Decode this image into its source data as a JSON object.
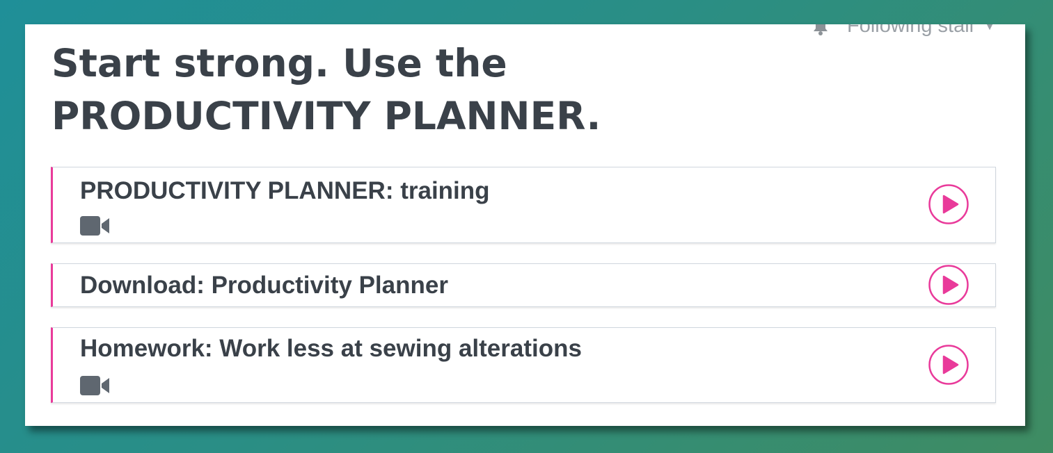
{
  "header": {
    "follow_label": "Following stall",
    "bell_icon": "bell-icon",
    "chevron_icon": "chevron-down-icon"
  },
  "section": {
    "title": "Start strong. Use the PRODUCTIVITY PLANNER."
  },
  "lessons": [
    {
      "title": "PRODUCTIVITY PLANNER: training",
      "has_video": true
    },
    {
      "title": "Download: Productivity Planner",
      "has_video": false
    },
    {
      "title": "Homework: Work less at sewing alterations",
      "has_video": true
    }
  ],
  "colors": {
    "accent": "#e93a9a",
    "text": "#3a4149",
    "icon": "#5f6770",
    "muted": "#9aa0a6"
  }
}
